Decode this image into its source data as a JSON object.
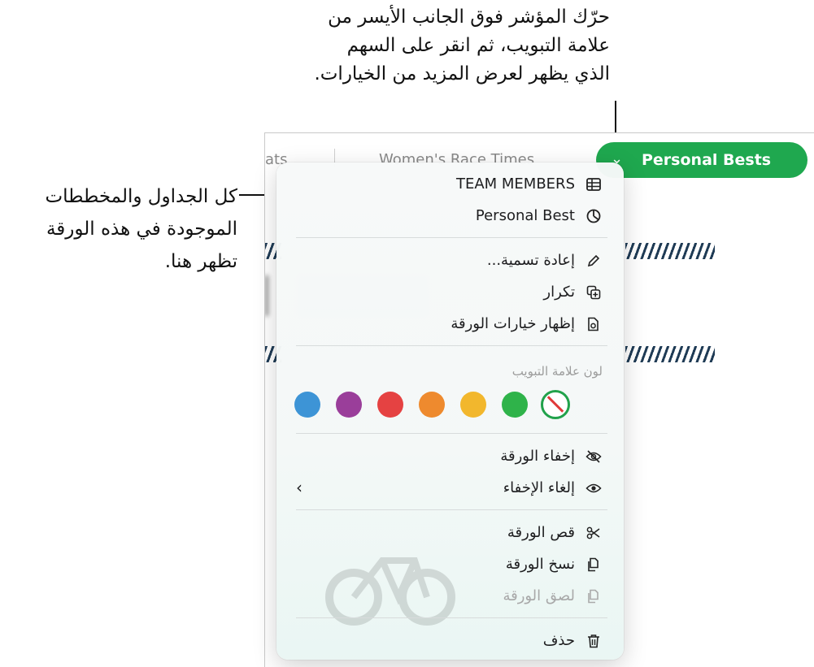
{
  "callouts": {
    "top": "حرّك المؤشر فوق الجانب الأيسر من علامة التبويب، ثم انقر على السهم الذي يظهر لعرض المزيد من الخيارات.",
    "left": "كل الجداول والمخططات الموجودة في هذه الورقة تظهر هنا."
  },
  "background_tabs": {
    "partial_tab": "ats",
    "middle_tab": "Women's Race Times"
  },
  "active_tab": {
    "label": "Personal Bests",
    "chevron": "⌄",
    "color": "#1fa84f"
  },
  "menu": {
    "objects": [
      {
        "label": "TEAM MEMBERS",
        "icon": "table-icon"
      },
      {
        "label": "Personal Best",
        "icon": "chart-icon"
      }
    ],
    "actions": [
      {
        "label": "إعادة تسمية...",
        "icon": "pencil-icon"
      },
      {
        "label": "تكرار",
        "icon": "duplicate-icon"
      },
      {
        "label": "إظهار خيارات الورقة",
        "icon": "sheet-options-icon"
      }
    ],
    "tab_color_title": "لون علامة التبويب",
    "tab_colors": [
      "#1fa84f",
      "#2fb34a",
      "#f2b72d",
      "#ee8a2e",
      "#e54242",
      "#9a3e9a",
      "#3d94d6"
    ],
    "visibility": [
      {
        "label": "إخفاء الورقة",
        "icon": "eye-slash-icon"
      },
      {
        "label": "إلغاء الإخفاء",
        "icon": "eye-icon",
        "submenu_arrow": "‹"
      }
    ],
    "clipboard": [
      {
        "label": "قص الورقة",
        "icon": "scissors-icon",
        "enabled": true
      },
      {
        "label": "نسخ الورقة",
        "icon": "copy-icon",
        "enabled": true
      },
      {
        "label": "لصق الورقة",
        "icon": "paste-icon",
        "enabled": false
      }
    ],
    "delete": {
      "label": "حذف",
      "icon": "trash-icon"
    }
  }
}
